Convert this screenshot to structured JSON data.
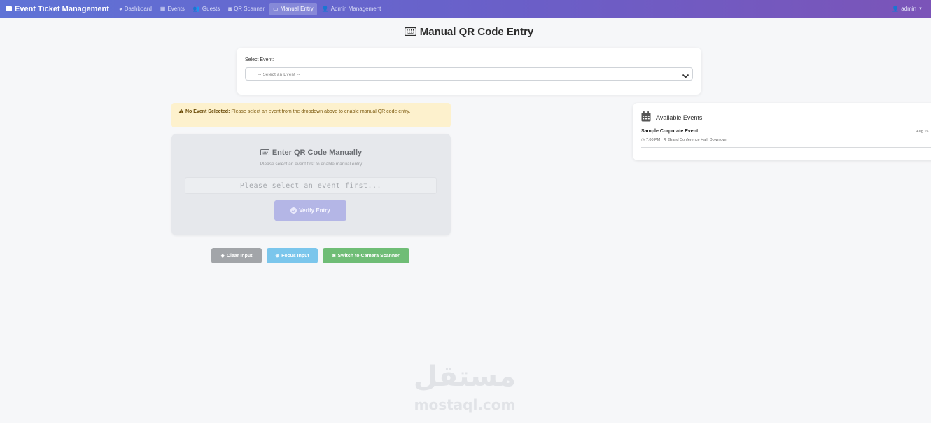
{
  "navbar": {
    "brand": "Event Ticket Management",
    "items": [
      {
        "label": "Dashboard",
        "icon": "dashboard-icon"
      },
      {
        "label": "Events",
        "icon": "calendar-icon"
      },
      {
        "label": "Guests",
        "icon": "users-icon"
      },
      {
        "label": "QR Scanner",
        "icon": "camera-icon"
      },
      {
        "label": "Manual Entry",
        "icon": "keyboard-icon",
        "active": true
      },
      {
        "label": "Admin Management",
        "icon": "user-cog-icon"
      }
    ],
    "user": "admin"
  },
  "page": {
    "title": "Manual QR Code Entry"
  },
  "event_select": {
    "label": "Select Event:",
    "value": "-- Select an Event --"
  },
  "alert": {
    "strong": "No Event Selected:",
    "message": "Please select an event from the dropdown above to enable manual QR code entry."
  },
  "entry": {
    "title": "Enter QR Code Manually",
    "subtitle": "Please select an event first to enable manual entry",
    "input_placeholder": "Please select an event first...",
    "verify_label": "Verify Entry"
  },
  "actions": {
    "clear": "Clear Input",
    "focus": "Focus Input",
    "camera": "Switch to Camera Scanner"
  },
  "available_events": {
    "title": "Available Events",
    "events": [
      {
        "name": "Sample Corporate Event",
        "date": "Aug 15",
        "time": "7:00 PM",
        "location": "Grand Conference Hall, Downtown"
      }
    ]
  },
  "watermark": {
    "arabic": "مستقل",
    "latin": "mostaql.com"
  },
  "colors": {
    "navbar_start": "#5f73d6",
    "navbar_end": "#7b54b8",
    "alert_bg": "#fdf1cd",
    "verify_btn": "#b4b6e6",
    "clear_btn": "#a2a5a9",
    "focus_btn": "#7bc6ec",
    "camera_btn": "#6fbd76"
  }
}
